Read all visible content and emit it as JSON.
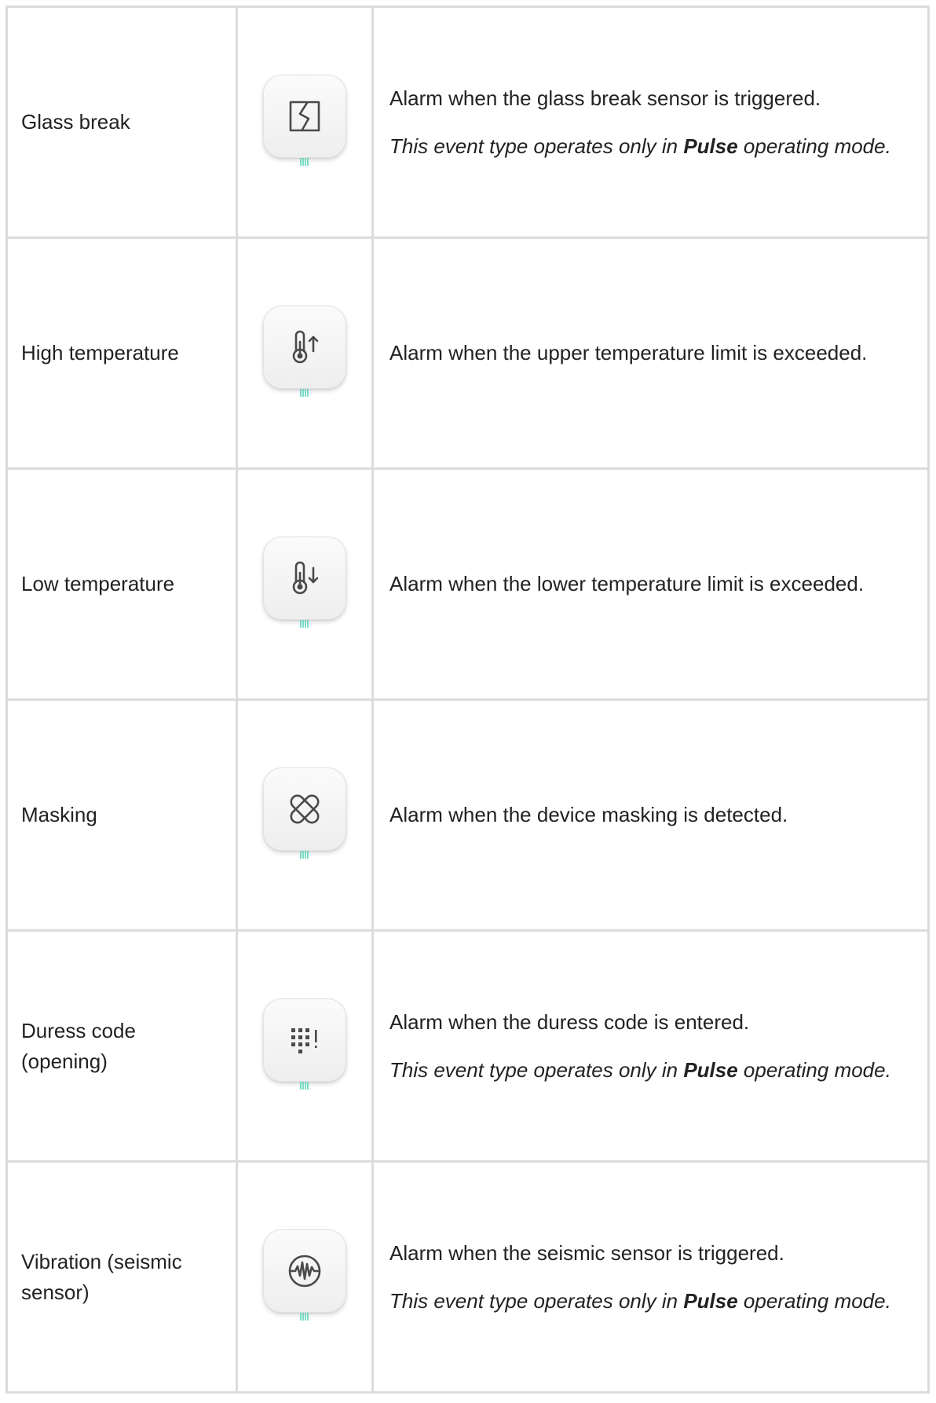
{
  "rows": [
    {
      "name": "Glass break",
      "icon": "glass-break-icon",
      "description": "Alarm when the glass break sensor is triggered.",
      "note_prefix": "This event type operates only in ",
      "note_bold": "Pulse",
      "note_suffix": " operating mode."
    },
    {
      "name": "High temperature",
      "icon": "high-temperature-icon",
      "description": "Alarm when the upper temperature limit is exceeded."
    },
    {
      "name": "Low temperature",
      "icon": "low-temperature-icon",
      "description": "Alarm when the lower temperature limit is exceeded."
    },
    {
      "name": "Masking",
      "icon": "masking-icon",
      "description": "Alarm when the device masking is detected."
    },
    {
      "name": "Duress code (opening)",
      "icon": "duress-code-icon",
      "description": "Alarm when the duress code is entered.",
      "note_prefix": "This event type operates only in ",
      "note_bold": "Pulse",
      "note_suffix": " operating mode."
    },
    {
      "name": "Vibration (seismic sensor)",
      "icon": "vibration-icon",
      "description": "Alarm when the seismic sensor is triggered.",
      "note_prefix": "This event type operates only in ",
      "note_bold": "Pulse",
      "note_suffix": " operating mode."
    }
  ],
  "colors": {
    "border": "#dcdcdc",
    "text": "#222222",
    "icon_stroke": "#4a4a4a",
    "led": "#4fd1b5"
  }
}
